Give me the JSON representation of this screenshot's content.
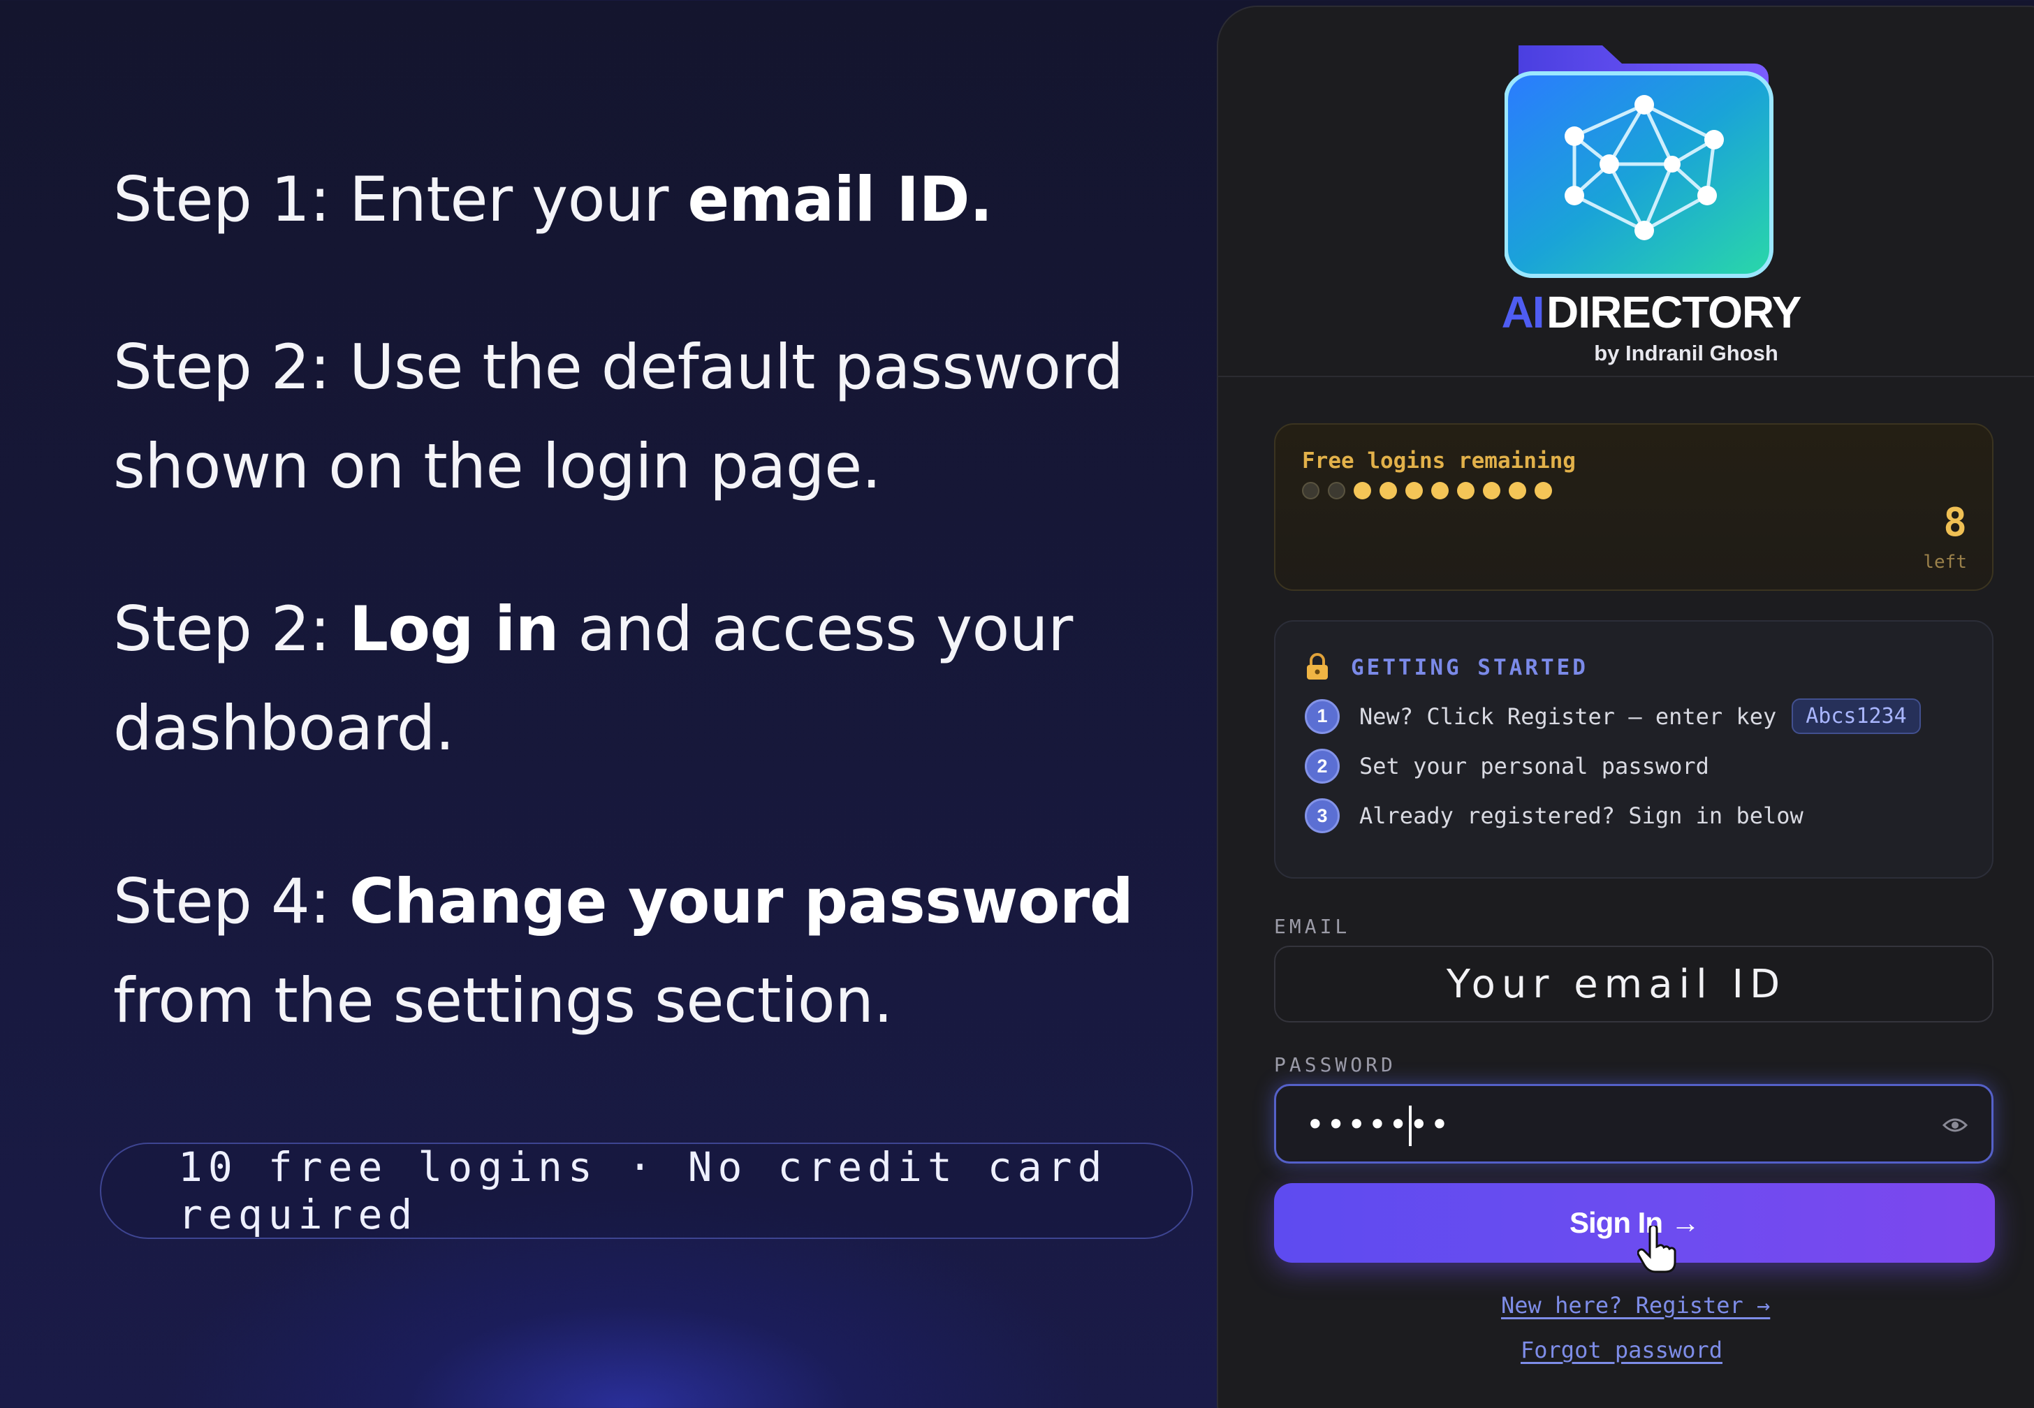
{
  "steps": [
    {
      "prefix": "Step 1: Enter your ",
      "bold": "email ID."
    },
    {
      "prefix": "Step 2: Use the default password",
      "line2": "shown on the login page."
    },
    {
      "prefix": "Step 2: ",
      "bold": "Log in",
      "suffix": " and access your",
      "line2": "dashboard."
    },
    {
      "prefix": "Step 4: ",
      "bold": "Change your password",
      "line2": "from the settings section."
    }
  ],
  "free_pill": "10 free logins · No credit card required",
  "brand": {
    "ai": "AI",
    "name": "DIRECTORY",
    "byline": "by Indranil Ghosh"
  },
  "quota": {
    "title": "Free logins remaining",
    "total": 10,
    "remaining": 8,
    "count": "8",
    "unit": "left",
    "accent": "#f4c557"
  },
  "guide": {
    "icon": "lock-icon",
    "title": "GETTING STARTED",
    "items": [
      {
        "num": "1",
        "text": "New? Click Register — enter key",
        "key": "Abcs1234"
      },
      {
        "num": "2",
        "text": "Set your personal password"
      },
      {
        "num": "3",
        "text": "Already registered? Sign in below"
      }
    ]
  },
  "form": {
    "email_label": "EMAIL",
    "email_value": "Your email ID",
    "password_label": "PASSWORD",
    "password_value": "•••••••",
    "signin_label": "Sign In",
    "signin_arrow": "→",
    "register_link": "New here? Register →",
    "forgot_link": "Forgot password"
  },
  "colors": {
    "accent": "#5e4bf0",
    "link": "#7e8de8",
    "gold": "#f0c054"
  }
}
